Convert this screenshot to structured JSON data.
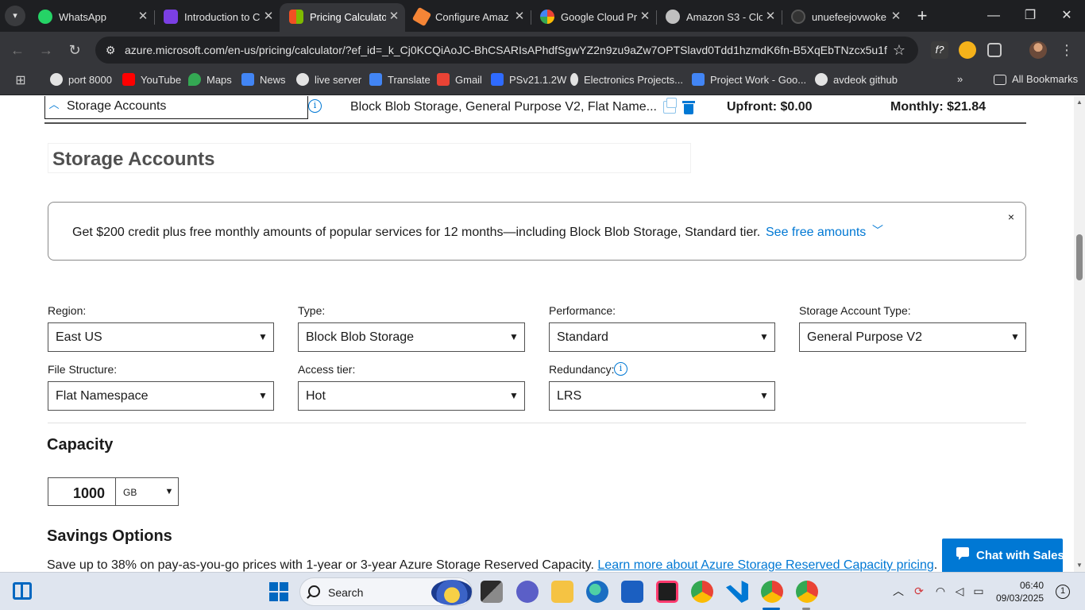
{
  "browser": {
    "tabs": [
      {
        "title": "WhatsApp",
        "favicon_color": "#25d366",
        "icon": "whatsapp-icon"
      },
      {
        "title": "Introduction to C",
        "favicon_color": "#7b3fe4",
        "icon": "course-icon"
      },
      {
        "title": "Pricing Calculato",
        "favicon_color": "#0078d4",
        "icon": "microsoft-icon",
        "active": true
      },
      {
        "title": "Configure Amaz",
        "favicon_color": "#f58536",
        "icon": "aws-icon"
      },
      {
        "title": "Google Cloud Pr",
        "favicon_color": "#4285f4",
        "icon": "google-cloud-icon"
      },
      {
        "title": "Amazon S3 - Clo",
        "favicon_color": "#c0c0c0",
        "icon": "s3-icon"
      },
      {
        "title": "unuefeejovwoke",
        "favicon_color": "#333333",
        "icon": "github-icon"
      }
    ],
    "url": "azure.microsoft.com/en-us/pricing/calculator/?ef_id=_k_Cj0KCQiAoJC-BhCSARIsAPhdfSgwYZ2n9zu9aZw7OPTSlavd0Tdd1hzmdK6fn-B5XqEbTNzcx5u1fZ0...",
    "bookmarks": [
      {
        "label": "port 8000",
        "color": "#e3e3e3"
      },
      {
        "label": "YouTube",
        "color": "#ff0000"
      },
      {
        "label": "Maps",
        "color": "#34a853"
      },
      {
        "label": "News",
        "color": "#4285f4"
      },
      {
        "label": "live server",
        "color": "#e3e3e3"
      },
      {
        "label": "Translate",
        "color": "#4285f4"
      },
      {
        "label": "Gmail",
        "color": "#ea4335"
      },
      {
        "label": "PSv21.1.2W",
        "color": "#2f6bff"
      },
      {
        "label": "Electronics Projects...",
        "color": "#e3e3e3"
      },
      {
        "label": "Project Work - Goo...",
        "color": "#4285f4"
      },
      {
        "label": "avdeok github",
        "color": "#e3e3e3"
      }
    ],
    "all_bookmarks": "All Bookmarks",
    "overflow": "»"
  },
  "service": {
    "name": "Storage Accounts",
    "description": "Block Blob Storage, General Purpose V2, Flat Name...",
    "upfront": "Upfront: $0.00",
    "monthly": "Monthly: $21.84",
    "title": "Storage Accounts"
  },
  "promo": {
    "message": "Get $200 credit plus free monthly amounts of popular services for 12 months—including Block Blob Storage, Standard tier.",
    "link": "See free amounts",
    "close": "×"
  },
  "fields": {
    "region": {
      "label": "Region:",
      "value": "East US"
    },
    "type": {
      "label": "Type:",
      "value": "Block Blob Storage"
    },
    "performance": {
      "label": "Performance:",
      "value": "Standard"
    },
    "account_type": {
      "label": "Storage Account Type:",
      "value": "General Purpose V2"
    },
    "file_structure": {
      "label": "File Structure:",
      "value": "Flat Namespace"
    },
    "access_tier": {
      "label": "Access tier:",
      "value": "Hot"
    },
    "redundancy": {
      "label": "Redundancy:",
      "value": "LRS"
    }
  },
  "capacity": {
    "heading": "Capacity",
    "value": "1000",
    "unit": "GB"
  },
  "savings": {
    "heading": "Savings Options",
    "text": "Save up to 38% on pay-as-you-go prices with 1-year or 3-year Azure Storage Reserved Capacity.",
    "link": "Learn more about Azure Storage Reserved Capacity pricing",
    "link_suffix": "."
  },
  "chat": {
    "label": "Chat with Sales"
  },
  "taskbar": {
    "search_label": "Search",
    "time": "06:40",
    "date": "09/03/2025",
    "notifications": "1"
  },
  "colors": {
    "accent": "#0078d4",
    "chrome_dark": "#35363a"
  }
}
